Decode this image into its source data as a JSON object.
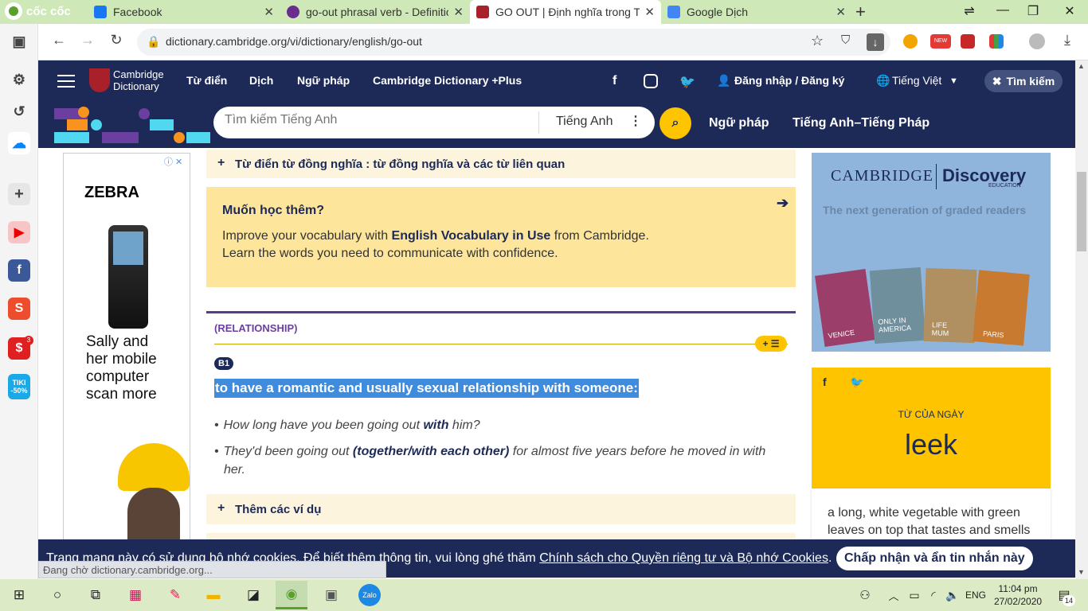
{
  "browser": {
    "brand": "cốc cốc",
    "tabs": [
      {
        "title": "Facebook",
        "color": "#1877f2"
      },
      {
        "title": "go-out phrasal verb - Definitio",
        "color": "#6a2c8e"
      },
      {
        "title": "GO OUT | Định nghĩa trong Ti",
        "color": "#a8202a"
      },
      {
        "title": "Google Dịch",
        "color": "#4285f4"
      }
    ],
    "new_tab": "+",
    "url": "dictionary.cambridge.org/vi/dictionary/english/go-out"
  },
  "header": {
    "logo_line1": "Cambridge",
    "logo_line2": "Dictionary",
    "nav": [
      "Từ điển",
      "Dịch",
      "Ngữ pháp",
      "Cambridge Dictionary +Plus"
    ],
    "login": "Đăng nhập / Đăng ký",
    "language": "Tiếng Việt",
    "close_search": "Tìm kiếm",
    "search_placeholder": "Tìm kiếm Tiếng Anh",
    "search_lang": "Tiếng Anh",
    "links2": [
      "Ngữ pháp",
      "Tiếng Anh–Tiếng Pháp"
    ]
  },
  "ad_left": {
    "brand": "ZEBRA",
    "text": "Sally and her mobile computer scan more"
  },
  "content": {
    "synonyms": "Từ điển từ đồng nghĩa : từ đồng nghĩa và các từ liên quan",
    "learn_title": "Muốn học thêm?",
    "learn_p1_a": "Improve your vocabulary with ",
    "learn_p1_b": "English Vocabulary in Use",
    "learn_p1_c": " from Cambridge.",
    "learn_p2": "Learn the words you need to communicate with confidence.",
    "guide": "(RELATIONSHIP)",
    "level": "B1",
    "definition": "to have a romantic and usually sexual relationship with someone:",
    "ex1_a": "How long have you been going out ",
    "ex1_b": "with",
    "ex1_c": " him?",
    "ex2_a": "They'd been going out ",
    "ex2_b": "(together/with each other)",
    "ex2_c": " for almost five years before he moved in with her.",
    "more_examples": "Thêm các ví dụ"
  },
  "ad_right": {
    "brand_a": "CAMBRIDGE",
    "brand_b": "Discovery",
    "brand_c": "EDUCATION",
    "tagline": "The next generation of graded readers",
    "books": [
      "VENICE",
      "ONLY IN AMERICA",
      "LIFE MUM",
      "PARIS"
    ]
  },
  "wotd": {
    "label": "TỪ CỦA NGÀY",
    "word": "leek",
    "definition": "a long, white vegetable with green leaves on top that tastes and smells"
  },
  "cookie": {
    "text": "Trang mạng này có sử dụng bộ nhớ cookies. Để biết thêm thông tin, vui lòng ghé thăm ",
    "link": "Chính sách cho Quyền riêng tư và Bộ nhớ Cookies",
    "period": ".",
    "accept": "Chấp nhận và ẩn tin nhắn này"
  },
  "status": "Đang chờ dictionary.cambridge.org...",
  "sidebar_badges": {
    "shop_count": "3",
    "tiki": "TIKI -50%"
  },
  "taskbar": {
    "lang": "ENG",
    "time": "11:04 pm",
    "date": "27/02/2020",
    "notif": "14"
  }
}
